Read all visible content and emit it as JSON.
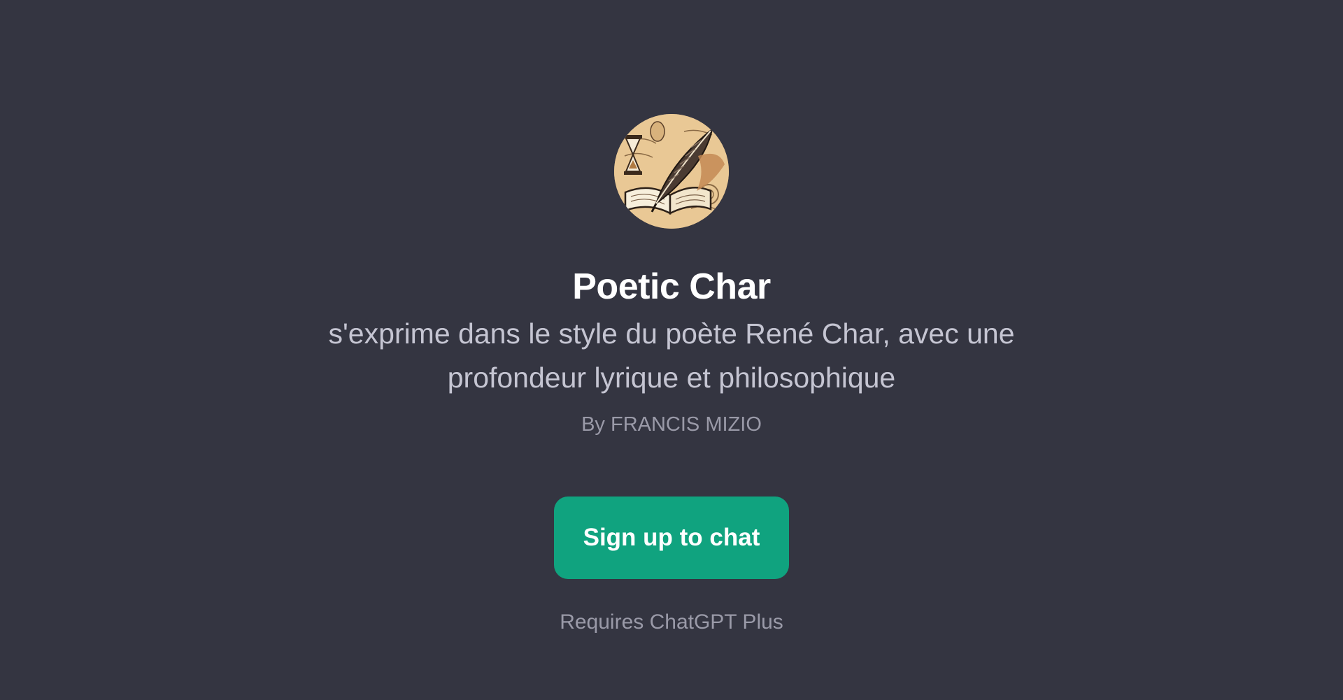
{
  "gpt": {
    "avatar_icon": "quill-book-hourglass-illustration",
    "name": "Poetic Char",
    "description": "s'exprime dans le style du poète René Char, avec une profondeur lyrique et philosophique",
    "author": "By FRANCIS MIZIO"
  },
  "actions": {
    "signup_label": "Sign up to chat"
  },
  "footer": {
    "requirement": "Requires ChatGPT Plus"
  },
  "colors": {
    "background": "#343541",
    "button": "#10a37f",
    "title_text": "#ffffff",
    "description_text": "#c5c5d2",
    "muted_text": "#9a9aa8"
  }
}
